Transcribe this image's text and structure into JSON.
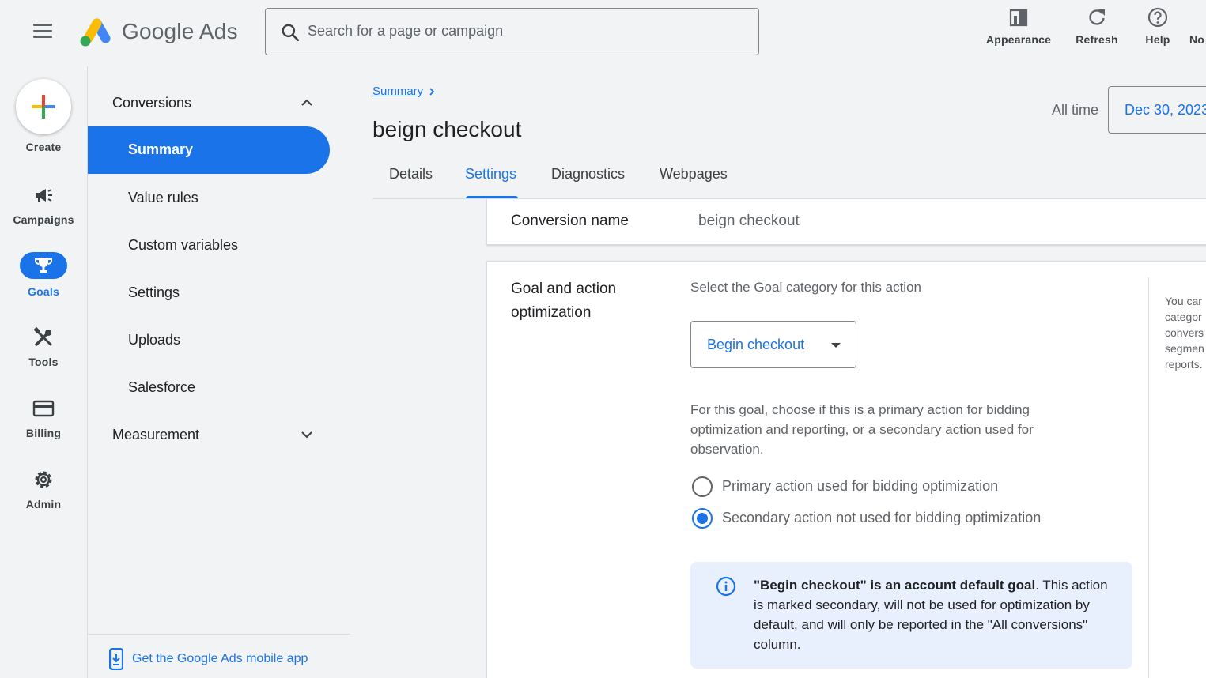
{
  "header": {
    "brand": "Google Ads",
    "search_placeholder": "Search for a page or campaign",
    "buttons": {
      "appearance": "Appearance",
      "refresh": "Refresh",
      "help": "Help",
      "notifications": "No"
    }
  },
  "rail": {
    "create": "Create",
    "campaigns": "Campaigns",
    "goals": "Goals",
    "tools": "Tools",
    "billing": "Billing",
    "admin": "Admin"
  },
  "subnav": {
    "section_conversions": "Conversions",
    "items": [
      "Summary",
      "Value rules",
      "Custom variables",
      "Settings",
      "Uploads",
      "Salesforce"
    ],
    "active_index": 0,
    "section_measurement": "Measurement",
    "footer_link": "Get the Google Ads mobile app"
  },
  "main": {
    "breadcrumb": "Summary",
    "title": "beign checkout",
    "date_label": "All time",
    "date_value": "Dec 30, 2023",
    "tabs": [
      "Details",
      "Settings",
      "Diagnostics",
      "Webpages"
    ],
    "active_tab": "Settings",
    "conversion_name_label": "Conversion name",
    "conversion_name_value": "beign checkout",
    "goal_section_label": "Goal and action optimization",
    "goal_prompt": "Select the Goal category for this action",
    "goal_selected": "Begin checkout",
    "goal_description": "For this goal, choose if this is a primary action for bidding optimization and reporting, or a secondary action used for observation.",
    "radio_primary": "Primary action used for bidding optimization",
    "radio_secondary": "Secondary action not used for bidding optimization",
    "selected_radio": "secondary",
    "info_bold": "\"Begin checkout\" is an account default goal",
    "info_rest": ". This action is marked secondary, will not be used for optimization by default, and will only be reported in the \"All conversions\" column.",
    "side_help": [
      "You car",
      "categor",
      "convers",
      "segmen",
      "reports."
    ]
  },
  "colors": {
    "accent": "#1a73e8",
    "background": "#f1f3f4",
    "info_bg": "#e8f0fe"
  }
}
